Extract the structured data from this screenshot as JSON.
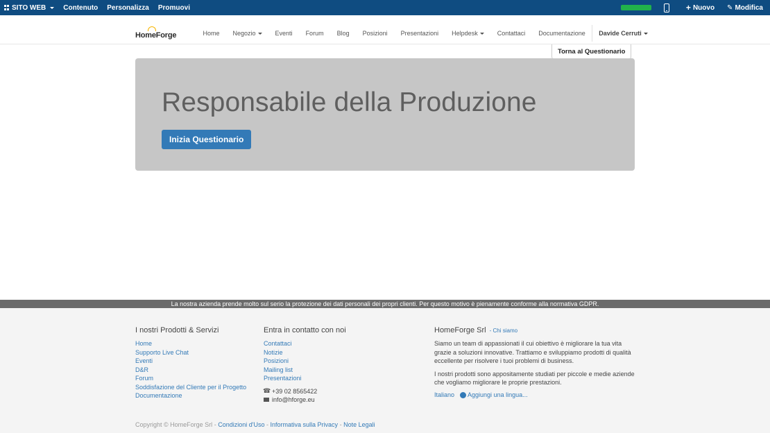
{
  "adminbar": {
    "site_label": "SITO WEB",
    "content_label": "Contenuto",
    "customize_label": "Personalizza",
    "promote_label": "Promuovi",
    "progress": 1.0,
    "new_label": "Nuovo",
    "edit_label": "Modifica",
    "colors": {
      "bg": "#0f4c81",
      "progress": "#21b24b"
    }
  },
  "nav": {
    "logo_text": "HomeForge",
    "items": [
      {
        "label": "Home"
      },
      {
        "label": "Negozio",
        "dropdown": true
      },
      {
        "label": "Eventi"
      },
      {
        "label": "Forum"
      },
      {
        "label": "Blog"
      },
      {
        "label": "Posizioni"
      },
      {
        "label": "Presentazioni"
      },
      {
        "label": "Helpdesk",
        "dropdown": true
      },
      {
        "label": "Contattaci"
      },
      {
        "label": "Documentazione"
      }
    ],
    "user_label": "Davide Cerruti"
  },
  "back_button_label": "Torna al Questionario",
  "hero": {
    "title": "Responsabile della Produzione",
    "start_button_label": "Inizia Questionario"
  },
  "gdpr_text": "La nostra azienda prende molto sul serio la protezione dei dati personali dei propri clienti. Per questo motivo è pienamente conforme alla normativa GDPR.",
  "footer": {
    "products": {
      "heading": "I nostri Prodotti & Servizi",
      "links": [
        "Home",
        "Supporto Live Chat",
        "Eventi",
        "D&R",
        "Forum",
        "Soddisfazione del Cliente per il Progetto",
        "Documentazione"
      ]
    },
    "contact": {
      "heading": "Entra in contatto con noi",
      "links": [
        "Contattaci",
        "Notizie",
        "Posizioni",
        "Mailing list",
        "Presentazioni"
      ],
      "phone": "+39 02 8565422",
      "email": "info@hforge.eu"
    },
    "company": {
      "heading": "HomeForge Srl",
      "about_link": "- Chi siamo",
      "paragraph1": "Siamo un team di appassionati il cui obiettivo è migliorare la tua vita grazie a soluzioni innovative. Trattiamo e sviluppiamo prodotti di qualità eccellente per risolvere i tuoi problemi di business.",
      "paragraph2": "I nostri prodotti sono appositamente studiati per piccole e medie aziende che vogliamo migliorare le proprie prestazioni.",
      "language": "Italiano",
      "add_language": "Aggiungi una lingua..."
    },
    "copyright": {
      "text": "Copyright © HomeForge Srl",
      "sep": "-",
      "terms": "Condizioni d'Uso",
      "privacy": "Informativa sulla Privacy",
      "legal": "Note Legali"
    }
  }
}
